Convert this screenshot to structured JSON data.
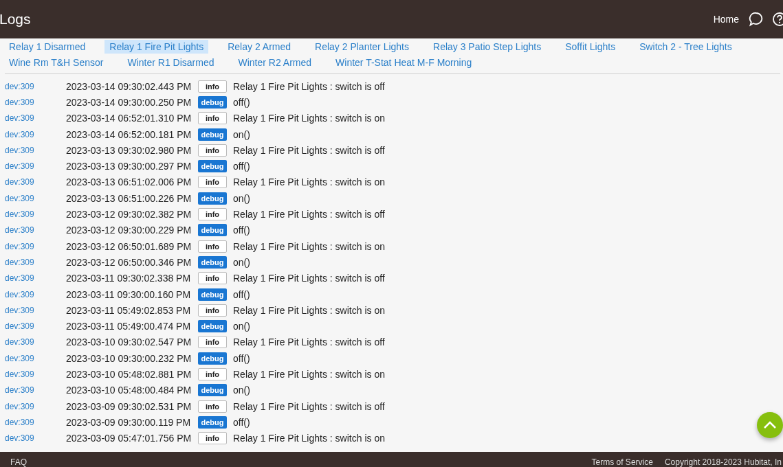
{
  "header": {
    "title": "Logs",
    "home": "Home"
  },
  "device_rows": [
    [
      {
        "label": "Relay 1 Disarmed",
        "selected": false
      },
      {
        "label": "Relay 1 Fire Pit Lights",
        "selected": true
      },
      {
        "label": "Relay 2 Armed",
        "selected": false
      },
      {
        "label": "Relay 2 Planter Lights",
        "selected": false
      },
      {
        "label": "Relay 3 Patio Step Lights",
        "selected": false
      },
      {
        "label": "Soffit Lights",
        "selected": false
      },
      {
        "label": "Switch 2 - Tree Lights",
        "selected": false
      }
    ],
    [
      {
        "label": "Wine Rm T&H Sensor",
        "selected": false
      },
      {
        "label": "Winter R1 Disarmed",
        "selected": false
      },
      {
        "label": "Winter R2 Armed",
        "selected": false
      },
      {
        "label": "Winter T-Stat Heat M-F Morning",
        "selected": false
      }
    ]
  ],
  "logs": [
    {
      "source": "dev:309",
      "time": "2023-03-14 09:30:02.443 PM",
      "kind": "info",
      "badge": "info",
      "message": "Relay 1 Fire Pit Lights : switch is off"
    },
    {
      "source": "dev:309",
      "time": "2023-03-14 09:30:00.250 PM",
      "kind": "debug",
      "badge": "debug",
      "message": "off()"
    },
    {
      "source": "dev:309",
      "time": "2023-03-14 06:52:01.310 PM",
      "kind": "info",
      "badge": "info",
      "message": "Relay 1 Fire Pit Lights : switch is on"
    },
    {
      "source": "dev:309",
      "time": "2023-03-14 06:52:00.181 PM",
      "kind": "debug",
      "badge": "debug",
      "message": "on()"
    },
    {
      "source": "dev:309",
      "time": "2023-03-13 09:30:02.980 PM",
      "kind": "info",
      "badge": "info",
      "message": "Relay 1 Fire Pit Lights : switch is off"
    },
    {
      "source": "dev:309",
      "time": "2023-03-13 09:30:00.297 PM",
      "kind": "debug",
      "badge": "debug",
      "message": "off()"
    },
    {
      "source": "dev:309",
      "time": "2023-03-13 06:51:02.006 PM",
      "kind": "info",
      "badge": "info",
      "message": "Relay 1 Fire Pit Lights : switch is on"
    },
    {
      "source": "dev:309",
      "time": "2023-03-13 06:51:00.226 PM",
      "kind": "debug",
      "badge": "debug",
      "message": "on()"
    },
    {
      "source": "dev:309",
      "time": "2023-03-12 09:30:02.382 PM",
      "kind": "info",
      "badge": "info",
      "message": "Relay 1 Fire Pit Lights : switch is off"
    },
    {
      "source": "dev:309",
      "time": "2023-03-12 09:30:00.229 PM",
      "kind": "debug",
      "badge": "debug",
      "message": "off()"
    },
    {
      "source": "dev:309",
      "time": "2023-03-12 06:50:01.689 PM",
      "kind": "info",
      "badge": "info",
      "message": "Relay 1 Fire Pit Lights : switch is on"
    },
    {
      "source": "dev:309",
      "time": "2023-03-12 06:50:00.346 PM",
      "kind": "debug",
      "badge": "debug",
      "message": "on()"
    },
    {
      "source": "dev:309",
      "time": "2023-03-11 09:30:02.338 PM",
      "kind": "info",
      "badge": "info",
      "message": "Relay 1 Fire Pit Lights : switch is off"
    },
    {
      "source": "dev:309",
      "time": "2023-03-11 09:30:00.160 PM",
      "kind": "debug",
      "badge": "debug",
      "message": "off()"
    },
    {
      "source": "dev:309",
      "time": "2023-03-11 05:49:02.853 PM",
      "kind": "info",
      "badge": "info",
      "message": "Relay 1 Fire Pit Lights : switch is on"
    },
    {
      "source": "dev:309",
      "time": "2023-03-11 05:49:00.474 PM",
      "kind": "debug",
      "badge": "debug",
      "message": "on()"
    },
    {
      "source": "dev:309",
      "time": "2023-03-10 09:30:02.547 PM",
      "kind": "info",
      "badge": "info",
      "message": "Relay 1 Fire Pit Lights : switch is off"
    },
    {
      "source": "dev:309",
      "time": "2023-03-10 09:30:00.232 PM",
      "kind": "debug",
      "badge": "debug",
      "message": "off()"
    },
    {
      "source": "dev:309",
      "time": "2023-03-10 05:48:02.881 PM",
      "kind": "info",
      "badge": "info",
      "message": "Relay 1 Fire Pit Lights : switch is on"
    },
    {
      "source": "dev:309",
      "time": "2023-03-10 05:48:00.484 PM",
      "kind": "debug",
      "badge": "debug",
      "message": "on()"
    },
    {
      "source": "dev:309",
      "time": "2023-03-09 09:30:02.531 PM",
      "kind": "info",
      "badge": "info",
      "message": "Relay 1 Fire Pit Lights : switch is off"
    },
    {
      "source": "dev:309",
      "time": "2023-03-09 09:30:00.119 PM",
      "kind": "debug",
      "badge": "debug",
      "message": "off()"
    },
    {
      "source": "dev:309",
      "time": "2023-03-09 05:47:01.756 PM",
      "kind": "info",
      "badge": "info",
      "message": "Relay 1 Fire Pit Lights : switch is on"
    }
  ],
  "footer": {
    "faq": "FAQ",
    "terms": "Terms of Service",
    "copyright": "Copyright 2018-2023 Hubitat, In"
  }
}
